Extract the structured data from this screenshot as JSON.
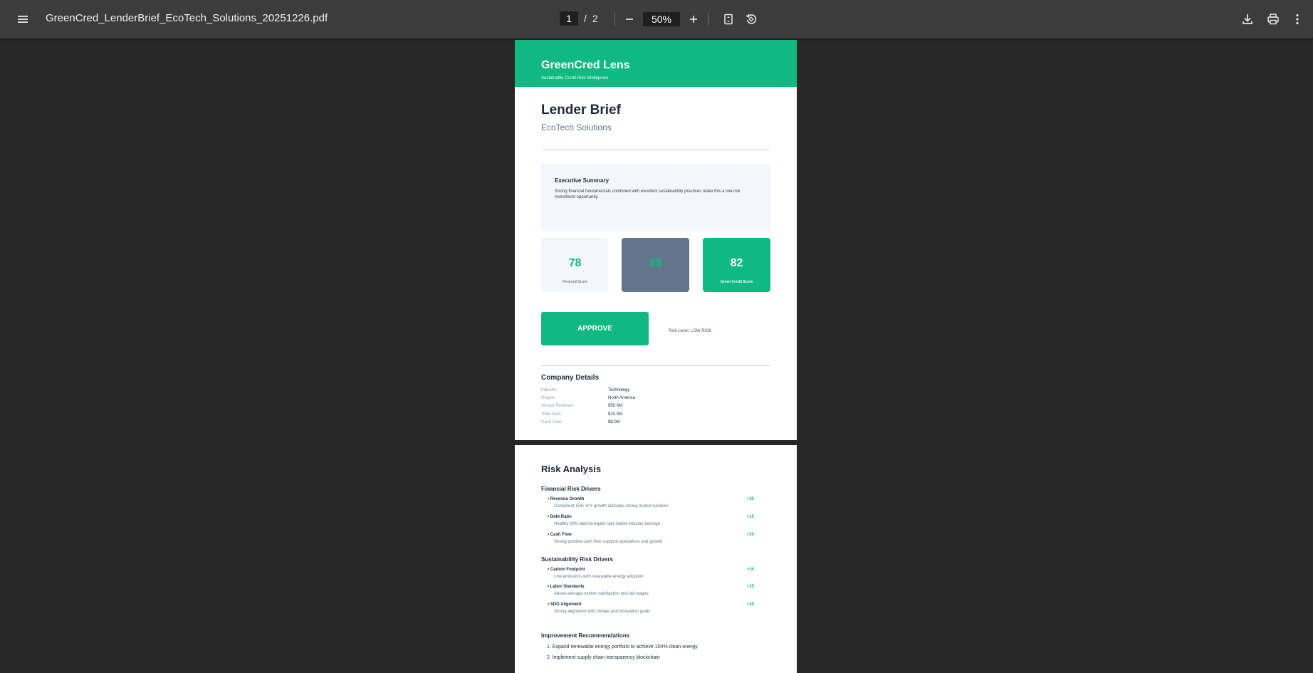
{
  "viewer": {
    "file_name": "GreenCred_LenderBrief_EcoTech_Solutions_20251226.pdf",
    "current_page": "1",
    "page_separator": "/",
    "total_pages": "2",
    "zoom": "50%"
  },
  "page1": {
    "brand": "GreenCred Lens",
    "tagline": "Sustainable Credit Risk Intelligence",
    "heading": "Lender Brief",
    "company": "EcoTech Solutions",
    "summary": {
      "title": "Executive Summary",
      "text": "Strong financial fundamentals combined with excellent sustainability practices make this a low-risk investment opportunity."
    },
    "scores": [
      {
        "value": "78",
        "label": "Financial Score"
      },
      {
        "value": "85",
        "label": ""
      },
      {
        "value": "82",
        "label": "Green Credit Score"
      }
    ],
    "decision": "APPROVE",
    "risk_level": "Risk Level: LOW RISK",
    "company_details": {
      "title": "Company Details",
      "rows": [
        {
          "key": "Industry:",
          "value": "Technology"
        },
        {
          "key": "Region:",
          "value": "North America"
        },
        {
          "key": "Annual Revenue:",
          "value": "$50.0M"
        },
        {
          "key": "Total Debt:",
          "value": "$10.0M"
        },
        {
          "key": "Cash Flow:",
          "value": "$8.0M"
        }
      ]
    }
  },
  "page2": {
    "title": "Risk Analysis",
    "financial": {
      "title": "Financial Risk Drivers",
      "drivers": [
        {
          "name": "• Revenue Growth",
          "desc": "Consistent 15% YoY growth indicates strong market position",
          "score": "+25"
        },
        {
          "name": "• Debt Ratio",
          "desc": "Healthy 20% debt-to-equity ratio below industry average",
          "score": "+15"
        },
        {
          "name": "• Cash Flow",
          "desc": "Strong positive cash flow supports operations and growth",
          "score": "+20"
        }
      ]
    },
    "sustainability": {
      "title": "Sustainability Risk Drivers",
      "drivers": [
        {
          "name": "• Carbon Footprint",
          "desc": "Low emissions with renewable energy adoption",
          "score": "+30"
        },
        {
          "name": "• Labor Standards",
          "desc": "Above-average worker satisfaction and fair wages",
          "score": "+25"
        },
        {
          "name": "• SDG Alignment",
          "desc": "Strong alignment with climate and innovation goals",
          "score": "+20"
        }
      ]
    },
    "recommendations": {
      "title": "Improvement Recommendations",
      "items": [
        "1. Expand renewable energy portfolio to achieve 100% clean energy",
        "2. Implement supply chain transparency blockchain"
      ]
    }
  },
  "colors": {
    "toolbar": "#3c3c3c",
    "background": "#282828",
    "brand_green": "#10b981",
    "slate": "#64748b"
  },
  "icons": [
    "menu-icon",
    "zoom-out-icon",
    "zoom-in-icon",
    "fit-page-icon",
    "rotate-icon",
    "download-icon",
    "print-icon",
    "more-vert-icon"
  ]
}
